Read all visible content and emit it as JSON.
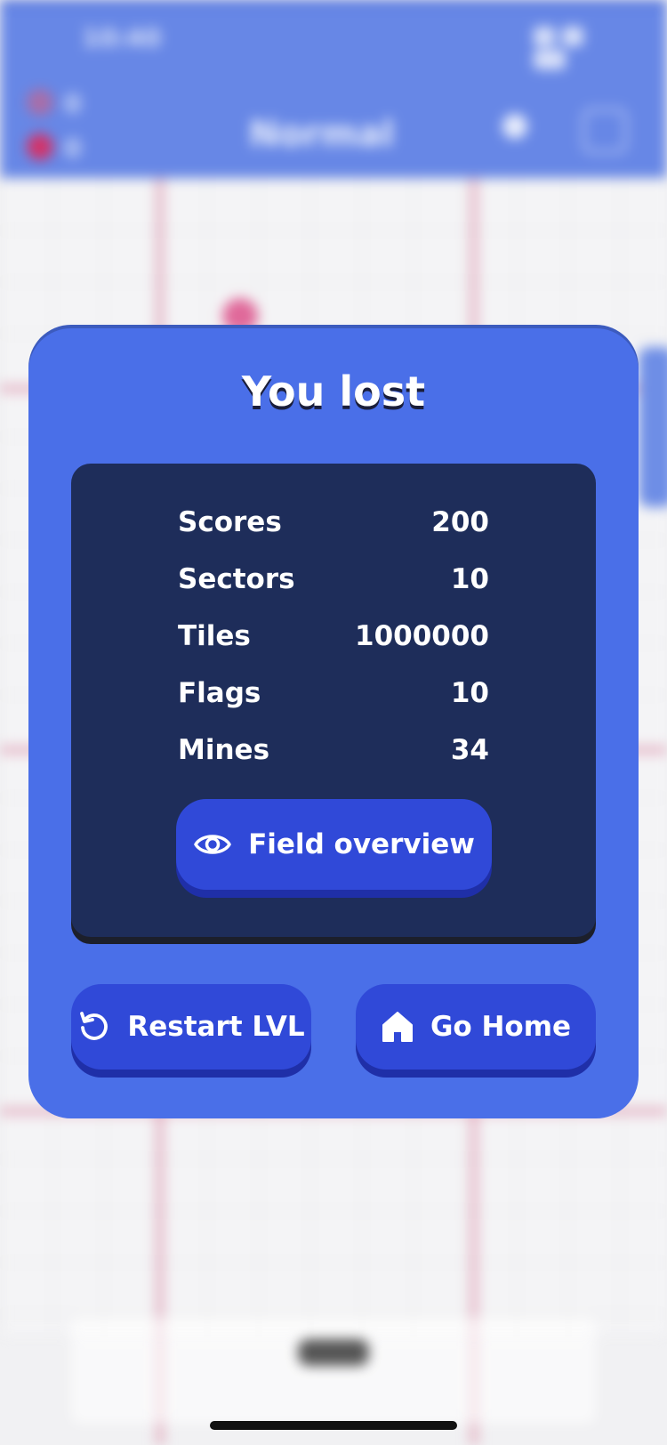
{
  "background": {
    "status_time": "10:40",
    "hearts_count_1": "0",
    "hearts_count_2": "0",
    "mode_title": "Normal"
  },
  "dialog": {
    "title": "You lost",
    "stats": [
      {
        "label": "Scores",
        "value": "200"
      },
      {
        "label": "Sectors",
        "value": "10"
      },
      {
        "label": "Tiles",
        "value": "1000000"
      },
      {
        "label": "Flags",
        "value": "10"
      },
      {
        "label": "Mines",
        "value": "34"
      }
    ],
    "field_overview_label": "Field overview",
    "restart_label": "Restart LVL",
    "home_label": "Go Home"
  },
  "colors": {
    "dialog_bg": "#4a6fe8",
    "panel_bg": "#1e2d5a",
    "button_bg": "#3049d8"
  },
  "icons": {
    "field_overview": "eye-icon",
    "restart": "restart-icon",
    "home": "home-icon"
  }
}
